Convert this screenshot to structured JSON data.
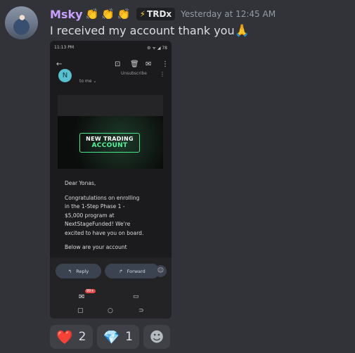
{
  "message": {
    "username": "Msky",
    "badge_emojis": [
      "👏",
      "👏",
      "👏"
    ],
    "tag": {
      "icon": "lightning-icon",
      "text": "TRDx"
    },
    "timestamp": "Yesterday at 12:45 AM",
    "content": "I received my account thank you",
    "content_emoji": "🙏",
    "colors": {
      "username": "#c9a0ff",
      "background": "#323339"
    }
  },
  "screenshot": {
    "status_time": "11:13 PM",
    "status_icons": "⚙ ᯤ ◢ 78",
    "toolbar": {
      "back": "←",
      "archive": "⊡",
      "delete": "🗑",
      "mail": "✉",
      "more": "⋮"
    },
    "sender_initial": "N",
    "to_me": "to me ⌄",
    "unsubscribe": "Unsubscribe",
    "banner": {
      "line1": "NEW TRADING",
      "line2": "ACCOUNT"
    },
    "body": [
      "Dear Yonas,",
      "Congratulations on enrolling\nin the 1-Step Phase 1 -\n$5,000 program at\nNextStageFunded! We're\nexcited to have you on board.",
      "Below are your account"
    ],
    "reply": "Reply",
    "forward": "Forward",
    "mail_badge": "99+"
  },
  "reactions": [
    {
      "emoji": "❤️",
      "icon": "heart-icon",
      "count": "2"
    },
    {
      "emoji": "💎",
      "icon": "gem-icon",
      "count": "1"
    }
  ]
}
